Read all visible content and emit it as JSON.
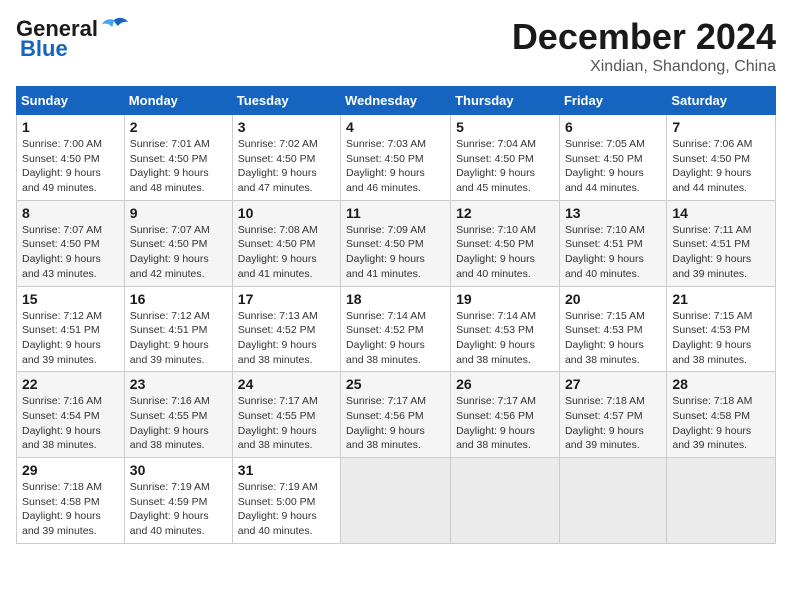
{
  "header": {
    "logo_line1": "General",
    "logo_line2": "Blue",
    "title": "December 2024",
    "subtitle": "Xindian, Shandong, China"
  },
  "calendar": {
    "days_of_week": [
      "Sunday",
      "Monday",
      "Tuesday",
      "Wednesday",
      "Thursday",
      "Friday",
      "Saturday"
    ],
    "weeks": [
      [
        {
          "day": "1",
          "sunrise": "7:00 AM",
          "sunset": "4:50 PM",
          "daylight": "9 hours and 49 minutes."
        },
        {
          "day": "2",
          "sunrise": "7:01 AM",
          "sunset": "4:50 PM",
          "daylight": "9 hours and 48 minutes."
        },
        {
          "day": "3",
          "sunrise": "7:02 AM",
          "sunset": "4:50 PM",
          "daylight": "9 hours and 47 minutes."
        },
        {
          "day": "4",
          "sunrise": "7:03 AM",
          "sunset": "4:50 PM",
          "daylight": "9 hours and 46 minutes."
        },
        {
          "day": "5",
          "sunrise": "7:04 AM",
          "sunset": "4:50 PM",
          "daylight": "9 hours and 45 minutes."
        },
        {
          "day": "6",
          "sunrise": "7:05 AM",
          "sunset": "4:50 PM",
          "daylight": "9 hours and 44 minutes."
        },
        {
          "day": "7",
          "sunrise": "7:06 AM",
          "sunset": "4:50 PM",
          "daylight": "9 hours and 44 minutes."
        }
      ],
      [
        {
          "day": "8",
          "sunrise": "7:07 AM",
          "sunset": "4:50 PM",
          "daylight": "9 hours and 43 minutes."
        },
        {
          "day": "9",
          "sunrise": "7:07 AM",
          "sunset": "4:50 PM",
          "daylight": "9 hours and 42 minutes."
        },
        {
          "day": "10",
          "sunrise": "7:08 AM",
          "sunset": "4:50 PM",
          "daylight": "9 hours and 41 minutes."
        },
        {
          "day": "11",
          "sunrise": "7:09 AM",
          "sunset": "4:50 PM",
          "daylight": "9 hours and 41 minutes."
        },
        {
          "day": "12",
          "sunrise": "7:10 AM",
          "sunset": "4:50 PM",
          "daylight": "9 hours and 40 minutes."
        },
        {
          "day": "13",
          "sunrise": "7:10 AM",
          "sunset": "4:51 PM",
          "daylight": "9 hours and 40 minutes."
        },
        {
          "day": "14",
          "sunrise": "7:11 AM",
          "sunset": "4:51 PM",
          "daylight": "9 hours and 39 minutes."
        }
      ],
      [
        {
          "day": "15",
          "sunrise": "7:12 AM",
          "sunset": "4:51 PM",
          "daylight": "9 hours and 39 minutes."
        },
        {
          "day": "16",
          "sunrise": "7:12 AM",
          "sunset": "4:51 PM",
          "daylight": "9 hours and 39 minutes."
        },
        {
          "day": "17",
          "sunrise": "7:13 AM",
          "sunset": "4:52 PM",
          "daylight": "9 hours and 38 minutes."
        },
        {
          "day": "18",
          "sunrise": "7:14 AM",
          "sunset": "4:52 PM",
          "daylight": "9 hours and 38 minutes."
        },
        {
          "day": "19",
          "sunrise": "7:14 AM",
          "sunset": "4:53 PM",
          "daylight": "9 hours and 38 minutes."
        },
        {
          "day": "20",
          "sunrise": "7:15 AM",
          "sunset": "4:53 PM",
          "daylight": "9 hours and 38 minutes."
        },
        {
          "day": "21",
          "sunrise": "7:15 AM",
          "sunset": "4:53 PM",
          "daylight": "9 hours and 38 minutes."
        }
      ],
      [
        {
          "day": "22",
          "sunrise": "7:16 AM",
          "sunset": "4:54 PM",
          "daylight": "9 hours and 38 minutes."
        },
        {
          "day": "23",
          "sunrise": "7:16 AM",
          "sunset": "4:55 PM",
          "daylight": "9 hours and 38 minutes."
        },
        {
          "day": "24",
          "sunrise": "7:17 AM",
          "sunset": "4:55 PM",
          "daylight": "9 hours and 38 minutes."
        },
        {
          "day": "25",
          "sunrise": "7:17 AM",
          "sunset": "4:56 PM",
          "daylight": "9 hours and 38 minutes."
        },
        {
          "day": "26",
          "sunrise": "7:17 AM",
          "sunset": "4:56 PM",
          "daylight": "9 hours and 38 minutes."
        },
        {
          "day": "27",
          "sunrise": "7:18 AM",
          "sunset": "4:57 PM",
          "daylight": "9 hours and 39 minutes."
        },
        {
          "day": "28",
          "sunrise": "7:18 AM",
          "sunset": "4:58 PM",
          "daylight": "9 hours and 39 minutes."
        }
      ],
      [
        {
          "day": "29",
          "sunrise": "7:18 AM",
          "sunset": "4:58 PM",
          "daylight": "9 hours and 39 minutes."
        },
        {
          "day": "30",
          "sunrise": "7:19 AM",
          "sunset": "4:59 PM",
          "daylight": "9 hours and 40 minutes."
        },
        {
          "day": "31",
          "sunrise": "7:19 AM",
          "sunset": "5:00 PM",
          "daylight": "9 hours and 40 minutes."
        },
        null,
        null,
        null,
        null
      ]
    ]
  }
}
